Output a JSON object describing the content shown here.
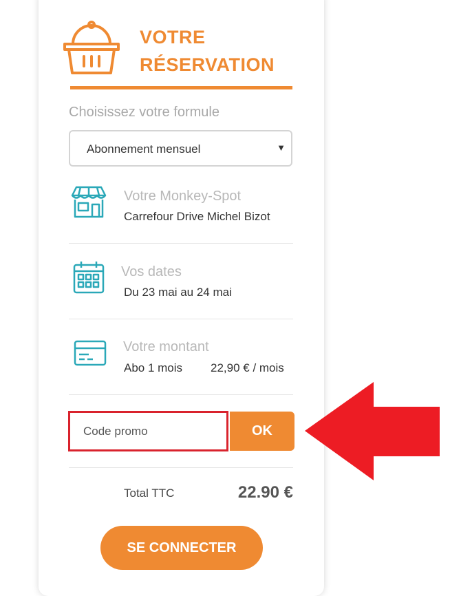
{
  "header": {
    "title_line1": "VOTRE",
    "title_line2": "RÉSERVATION"
  },
  "formule": {
    "label": "Choisissez votre formule",
    "selected": "Abonnement mensuel"
  },
  "spot": {
    "title": "Votre Monkey-Spot",
    "value": "Carrefour Drive Michel Bizot"
  },
  "dates": {
    "title": "Vos dates",
    "value": "Du 23 mai au 24 mai"
  },
  "montant": {
    "title": "Votre montant",
    "plan": "Abo 1 mois",
    "price": "22,90 € / mois"
  },
  "promo": {
    "placeholder": "Code promo",
    "button": "OK"
  },
  "total": {
    "label": "Total TTC",
    "value": "22.90 €"
  },
  "cta": {
    "label": "SE CONNECTER"
  },
  "colors": {
    "accent": "#ef8a32",
    "icon": "#2aa8b8",
    "highlight": "#d9232d",
    "arrow": "#ed1c24"
  },
  "icons": [
    "basket-icon",
    "store-icon",
    "calendar-icon",
    "credit-card-icon",
    "dropdown-arrow-icon",
    "red-arrow-annotation"
  ]
}
